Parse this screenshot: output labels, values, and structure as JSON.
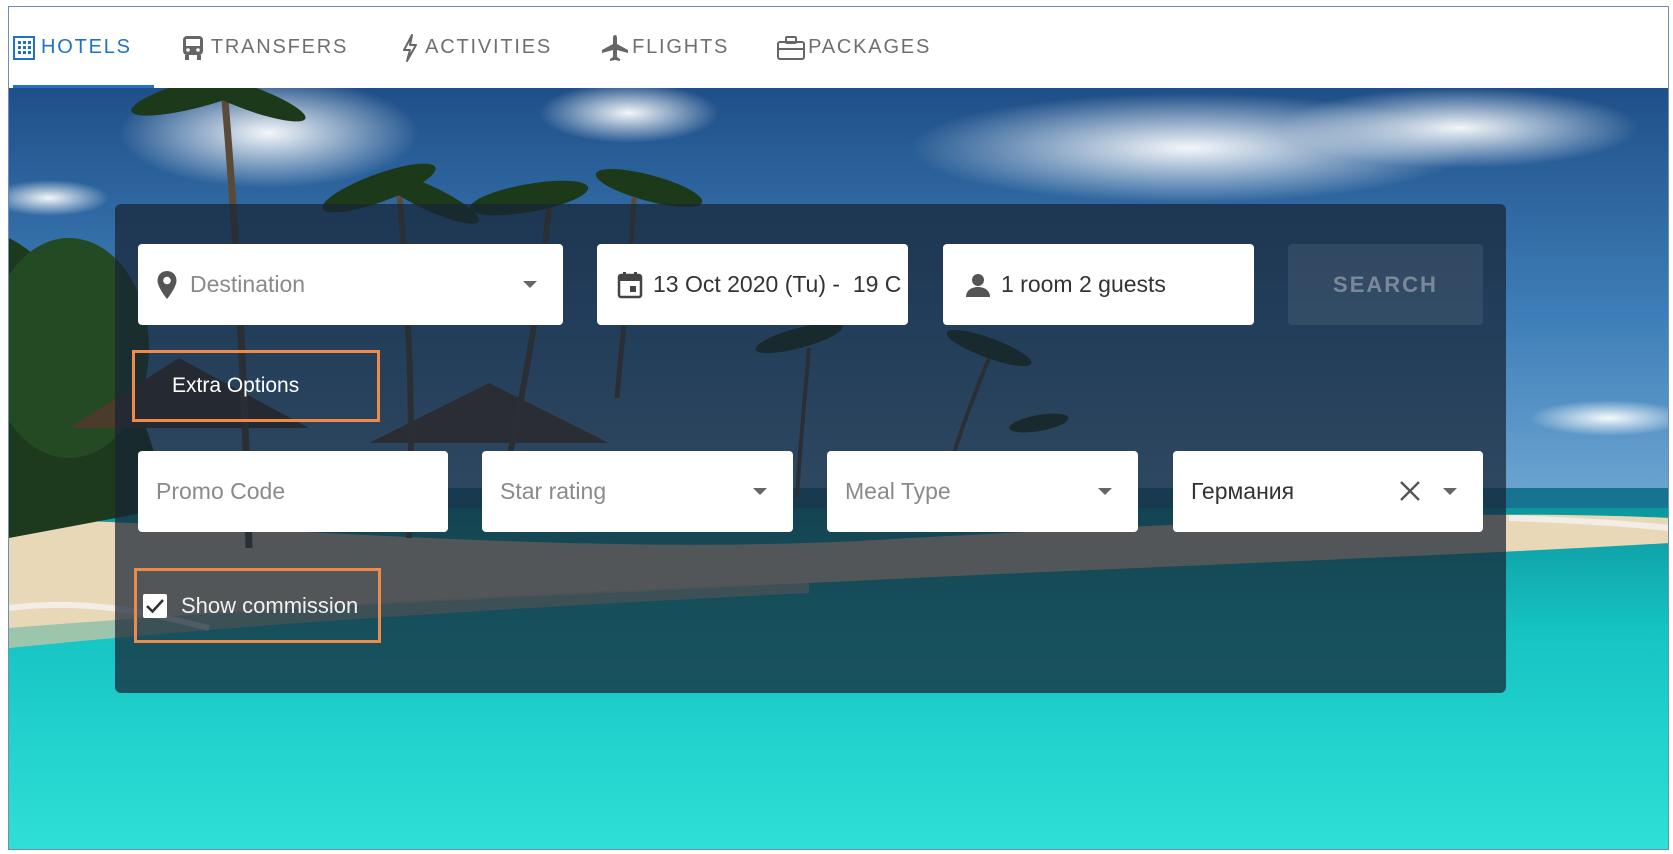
{
  "tabs": [
    {
      "label": "HOTELS",
      "icon": "building-icon",
      "active": true
    },
    {
      "label": "TRANSFERS",
      "icon": "bus-icon",
      "active": false
    },
    {
      "label": "ACTIVITIES",
      "icon": "bolt-icon",
      "active": false
    },
    {
      "label": "FLIGHTS",
      "icon": "airplane-icon",
      "active": false
    },
    {
      "label": "PACKAGES",
      "icon": "suitcase-icon",
      "active": false
    }
  ],
  "search": {
    "destination_placeholder": "Destination",
    "dates_value": "13 Oct 2020 (Tu) -  19 C",
    "guests_value": "1 room 2 guests",
    "search_label": "SEARCH"
  },
  "extra_options_label": "Extra Options",
  "filters": {
    "promo_placeholder": "Promo Code",
    "star_placeholder": "Star rating",
    "meal_placeholder": "Meal Type",
    "country_value": "Германия"
  },
  "show_commission": {
    "label": "Show commission",
    "checked": true
  },
  "colors": {
    "accent": "#1e73c8",
    "highlight": "#f08a4b",
    "panel": "#182434"
  }
}
